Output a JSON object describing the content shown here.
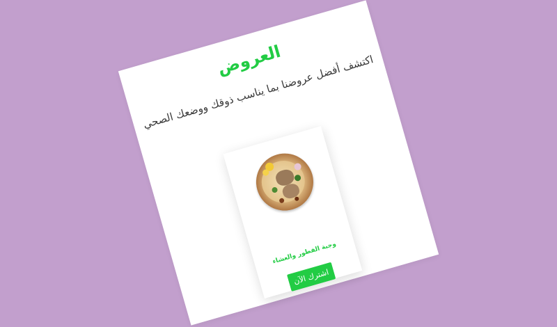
{
  "offers_section": {
    "title": "العروض",
    "subtitle": "اكتشف أفضل عروضنا بما يناسب ذوقك ووضعك الصحي",
    "offer": {
      "name": "وجبة الفطور والعشاء",
      "button_label": "اشترك الآن",
      "image_icon": "rice-dish-image"
    }
  },
  "colors": {
    "accent": "#22cc44",
    "background": "#c29fcd",
    "card": "#ffffff"
  }
}
